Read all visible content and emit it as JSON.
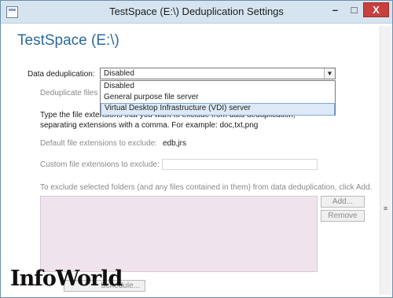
{
  "window": {
    "title": "TestSpace (E:\\) Deduplication Settings",
    "controls": {
      "minimize": "–",
      "maximize": "□",
      "close": "X"
    }
  },
  "page_title": "TestSpace (E:\\)",
  "dedup": {
    "label": "Data deduplication:",
    "selected": "Disabled",
    "options": [
      "Disabled",
      "General purpose file server",
      "Virtual Desktop Infrastructure (VDI) server"
    ],
    "highlighted_index": 2
  },
  "files_older_label": "Deduplicate files old",
  "file_ext_description": "Type the file extensions that you want to exclude from data deduplication, separating extensions with a comma. For example: doc,txt,png",
  "default_ext": {
    "label": "Default file extensions to exclude:",
    "value": "edb,jrs"
  },
  "custom_ext": {
    "label": "Custom file extensions to exclude:",
    "value": ""
  },
  "folders_instruction": "To exclude selected folders (and any files contained in them) from data deduplication, click Add.",
  "buttons": {
    "add": "Add...",
    "remove": "Remove",
    "schedule": "Schedule..."
  },
  "watermark": "InfoWorld",
  "icons": {
    "app": "window-icon",
    "dropdown": "chevron-down-icon",
    "scroll": "scroll-grip-icon"
  }
}
